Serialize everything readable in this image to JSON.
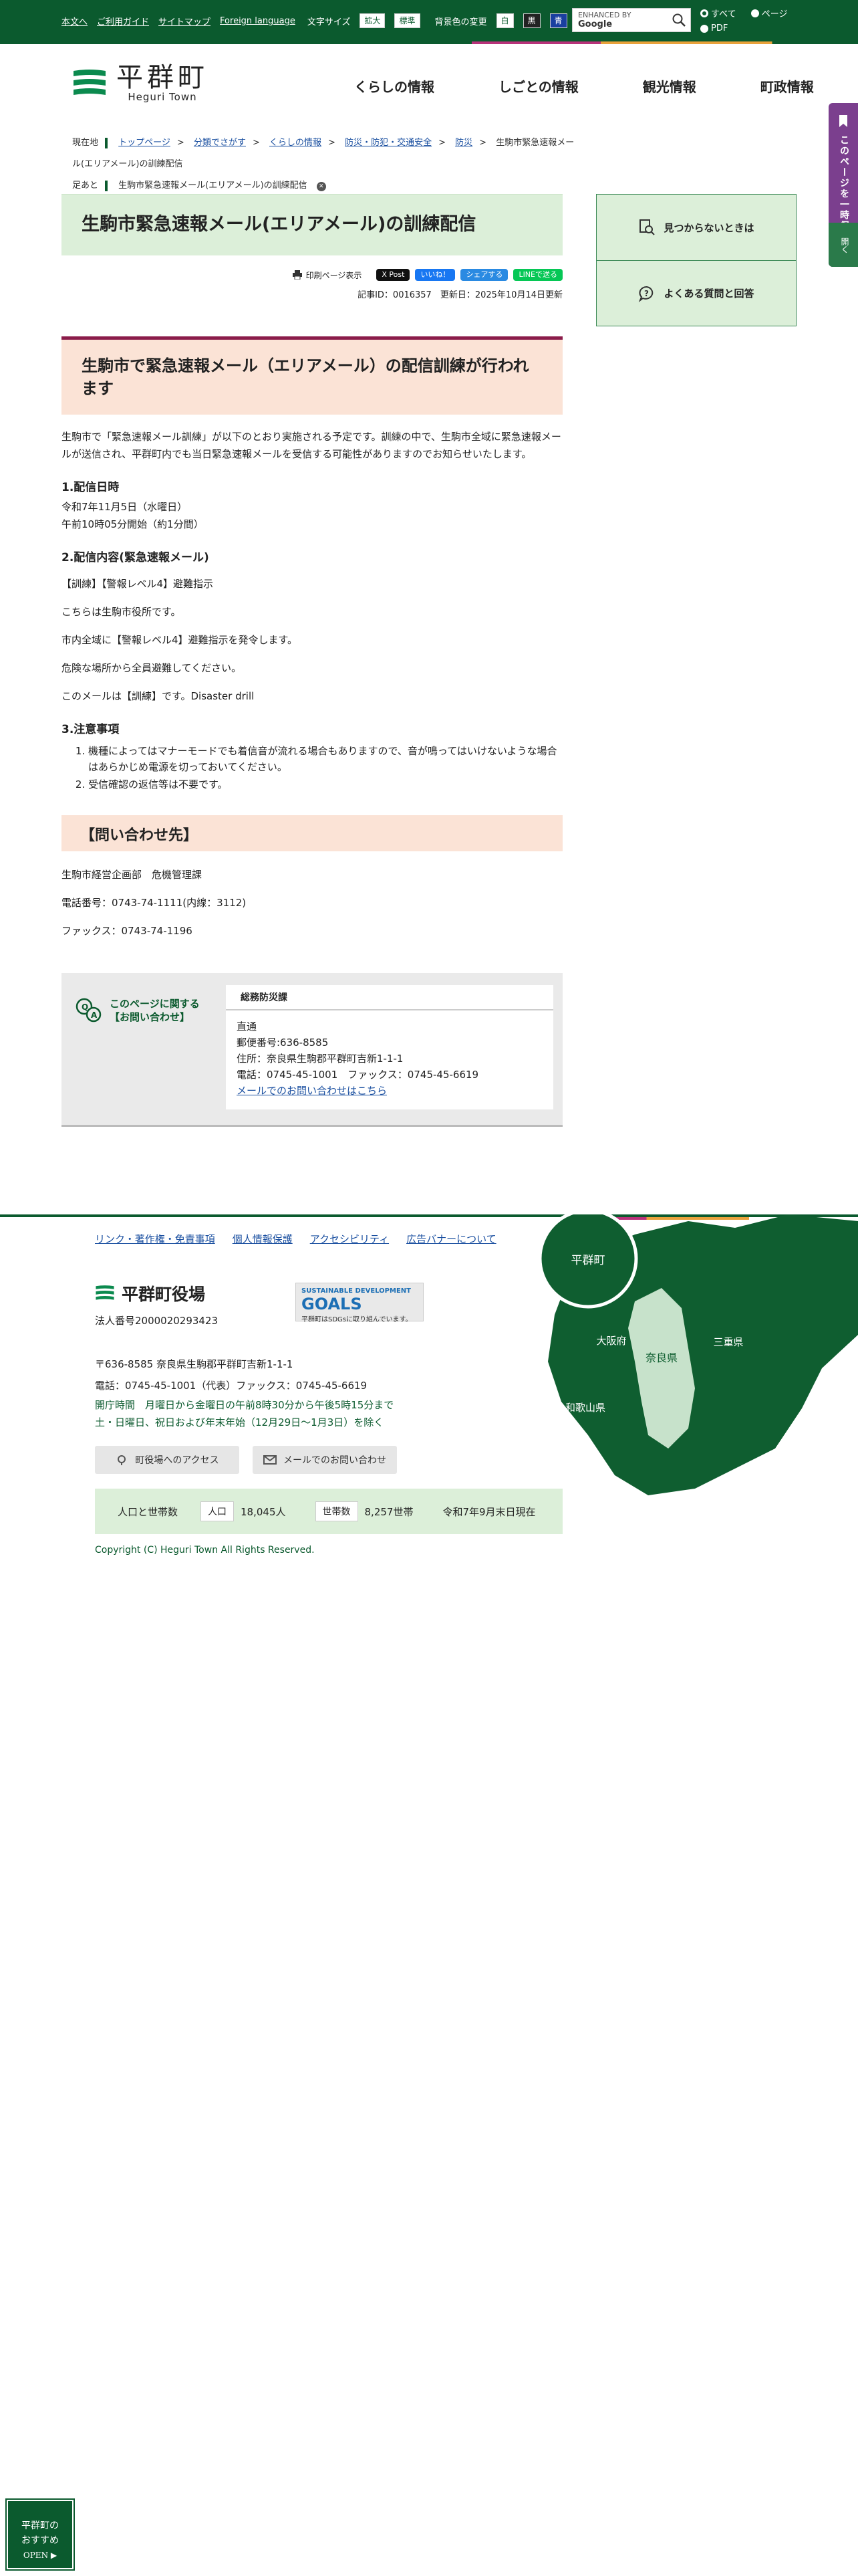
{
  "topbar": {
    "links": [
      "本文へ",
      "ご利用ガイド",
      "サイトマップ",
      "Foreign language"
    ],
    "font_size_label": "文字サイズ",
    "font_size_buttons": [
      "拡大",
      "標準"
    ],
    "bg_color_label": "背景色の変更",
    "bg_color_buttons": [
      "白",
      "黒",
      "青"
    ],
    "search_placeholder_prefix": "ENHANCED BY",
    "search_placeholder_brand": "Google",
    "radio_options": [
      "すべて",
      "ページ",
      "PDF"
    ]
  },
  "logo": {
    "name": "平群町",
    "sub": "Heguri Town"
  },
  "global_nav": [
    "くらしの情報",
    "しごとの情報",
    "観光情報",
    "町政情報"
  ],
  "side_tab": {
    "label": "このページを一時保存する",
    "open_label": "開く"
  },
  "breadcrumb": {
    "label": "現在地",
    "items": [
      "トップページ",
      "分類でさがす",
      "くらしの情報",
      "防災・防犯・交通安全",
      "防災"
    ],
    "current": "生駒市緊急速報メール(エリアメール)の訓練配信",
    "footprint_label": "足あと",
    "footprint_item": "生駒市緊急速報メール(エリアメール)の訓練配信",
    "footprint_close": "✕"
  },
  "page_title": "生駒市緊急速報メール(エリアメール)の訓練配信",
  "tools": {
    "print": "印刷ページ表示",
    "sns": [
      "X Post",
      "いいね！",
      "シェアする",
      "LINEで送る"
    ],
    "meta": "記事ID：0016357　更新日：2025年10月14日更新"
  },
  "article": {
    "heading": "生駒市で緊急速報メール（エリアメール）の配信訓練が行われます",
    "intro": "生駒市で「緊急速報メール訓練」が以下のとおり実施される予定です。訓練の中で、生駒市全域に緊急速報メールが送信され、平群町内でも当日緊急速報メールを受信する可能性がありますのでお知らせいたします。",
    "s1_title": "1.配信日時",
    "s1_lines": [
      "令和7年11月5日（水曜日）",
      "午前10時05分開始（約1分間）"
    ],
    "s2_title": "2.配信内容(緊急速報メール)",
    "s2_lines": [
      "【訓練】【警報レベル4】避難指示",
      "こちらは生駒市役所です。",
      "市内全域に【警報レベル4】避難指示を発令します。",
      "危険な場所から全員避難してください。",
      "このメールは【訓練】です。Disaster drill"
    ],
    "s3_title": "3.注意事項",
    "s3_items": [
      "機種によってはマナーモードでも着信音が流れる場合もありますので、音が鳴ってはいけないような場合はあらかじめ電源を切っておいてください。",
      "受信確認の返信等は不要です。"
    ],
    "inq_heading": "【問い合わせ先】",
    "inq_lines": [
      "生駒市経営企画部　危機管理課",
      "電話番号：0743-74-1111(内線：3112)",
      "ファックス：0743-74-1196"
    ]
  },
  "contact": {
    "title_line1": "このページに関する",
    "title_line2": "【お問い合わせ】",
    "dept": "総務防災課",
    "lines": [
      "直通",
      "郵便番号:636-8585",
      "住所：奈良県生駒郡平群町吉新1-1-1",
      "電話：0745-45-1001　ファックス：0745-45-6619"
    ],
    "mail_link": "メールでのお問い合わせはこちら"
  },
  "side_box": [
    "見つからないときは",
    "よくある質問と回答"
  ],
  "footer": {
    "links": [
      "リンク・著作権・免責事項",
      "個人情報保護",
      "アクセシビリティ",
      "広告バナーについて"
    ],
    "office_name": "平群町役場",
    "corp_no": "法人番号2000020293423",
    "sdg_line1": "SUSTAINABLE DEVELOPMENT",
    "sdg_goals": "GOALS",
    "sdg_line2": "平群町はSDGsに取り組んでいます。",
    "address": "〒636-8585 奈良県生駒郡平群町吉新1-1-1",
    "tel": "電話：0745-45-1001（代表）ファックス：0745-45-6619",
    "hours1": "開庁時間　月曜日から金曜日の午前8時30分から午後5時15分まで",
    "hours2": "土・日曜日、祝日および年末年始（12月29日～1月3日）を除く",
    "btn_access": "町役場へのアクセス",
    "btn_mail": "メールでのお問い合わせ",
    "pop_label": "人口と世帯数",
    "pop_tag": "人口",
    "pop_value": "18,045人",
    "hh_tag": "世帯数",
    "hh_value": "8,257世帯",
    "as_of": "令和7年9月末日現在",
    "copyright": "Copyright (C) Heguri Town All Rights Reserved.",
    "map_labels": [
      "平群町",
      "大阪府",
      "奈良県",
      "三重県",
      "和歌山県"
    ]
  },
  "float_button": {
    "line1": "平群町の",
    "line2": "おすすめ",
    "line3": "OPEN ▶"
  }
}
